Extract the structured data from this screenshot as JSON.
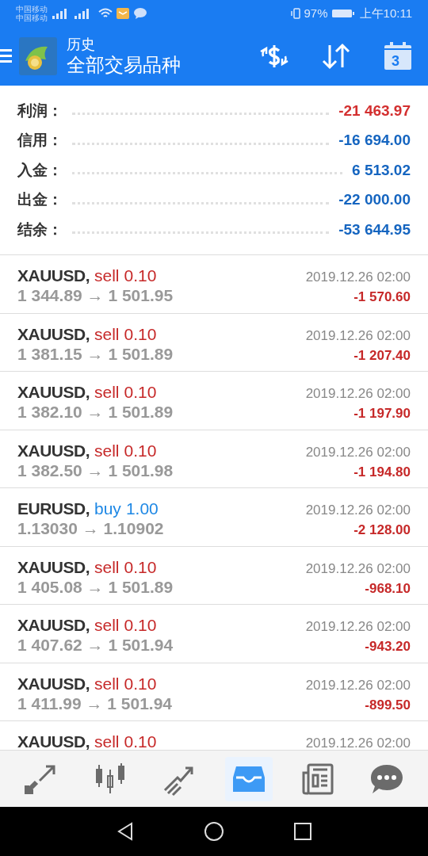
{
  "status_bar": {
    "carriers": [
      "中国移动",
      "中国移动"
    ],
    "battery": "97%",
    "time": "上午10:11"
  },
  "toolbar": {
    "title": "历史",
    "subtitle": "全部交易品种",
    "calendar_day": "3"
  },
  "summary": [
    {
      "label": "利润：",
      "value": "-21 463.97",
      "color": "#d32f2f"
    },
    {
      "label": "信用：",
      "value": "-16 694.00",
      "color": "#1565c0"
    },
    {
      "label": "入金：",
      "value": "6 513.02",
      "color": "#1565c0"
    },
    {
      "label": "出金：",
      "value": "-22 000.00",
      "color": "#1565c0"
    },
    {
      "label": "结余：",
      "value": "-53 644.95",
      "color": "#1565c0"
    }
  ],
  "trades": [
    {
      "symbol": "XAUUSD,",
      "side": "sell",
      "volume": "0.10",
      "prices": "1 344.89 → 1 501.95",
      "time": "2019.12.26 02:00",
      "profit": "-1 570.60"
    },
    {
      "symbol": "XAUUSD,",
      "side": "sell",
      "volume": "0.10",
      "prices": "1 381.15 → 1 501.89",
      "time": "2019.12.26 02:00",
      "profit": "-1 207.40"
    },
    {
      "symbol": "XAUUSD,",
      "side": "sell",
      "volume": "0.10",
      "prices": "1 382.10 → 1 501.89",
      "time": "2019.12.26 02:00",
      "profit": "-1 197.90"
    },
    {
      "symbol": "XAUUSD,",
      "side": "sell",
      "volume": "0.10",
      "prices": "1 382.50 → 1 501.98",
      "time": "2019.12.26 02:00",
      "profit": "-1 194.80"
    },
    {
      "symbol": "EURUSD,",
      "side": "buy",
      "volume": "1.00",
      "prices": "1.13030 → 1.10902",
      "time": "2019.12.26 02:00",
      "profit": "-2 128.00"
    },
    {
      "symbol": "XAUUSD,",
      "side": "sell",
      "volume": "0.10",
      "prices": "1 405.08 → 1 501.89",
      "time": "2019.12.26 02:00",
      "profit": "-968.10"
    },
    {
      "symbol": "XAUUSD,",
      "side": "sell",
      "volume": "0.10",
      "prices": "1 407.62 → 1 501.94",
      "time": "2019.12.26 02:00",
      "profit": "-943.20"
    },
    {
      "symbol": "XAUUSD,",
      "side": "sell",
      "volume": "0.10",
      "prices": "1 411.99 → 1 501.94",
      "time": "2019.12.26 02:00",
      "profit": "-899.50"
    },
    {
      "symbol": "XAUUSD,",
      "side": "sell",
      "volume": "0.10",
      "time": "2019.12.26 02:00"
    }
  ],
  "bottom_tabs": [
    {
      "kind": "quotes",
      "selected": false
    },
    {
      "kind": "chart",
      "selected": false
    },
    {
      "kind": "trade",
      "selected": false
    },
    {
      "kind": "history",
      "selected": true
    },
    {
      "kind": "news",
      "selected": false
    },
    {
      "kind": "chat",
      "selected": false
    }
  ]
}
